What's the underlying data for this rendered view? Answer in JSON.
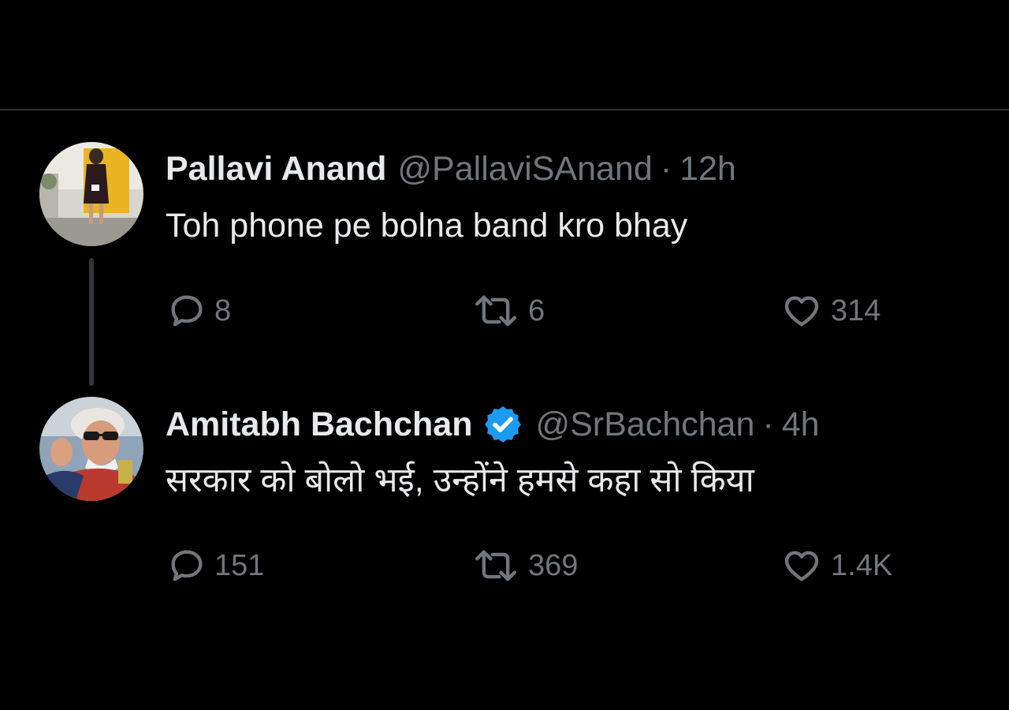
{
  "tweets": [
    {
      "name": "Pallavi Anand",
      "handle": "@PallaviSAnand",
      "separator": "·",
      "time": "12h",
      "verified": false,
      "avatar_icon": "avatar-photo",
      "text": "Toh phone pe bolna band kro bhay",
      "replies": "8",
      "retweets": "6",
      "likes": "314"
    },
    {
      "name": "Amitabh Bachchan",
      "handle": "@SrBachchan",
      "separator": "·",
      "time": "4h",
      "verified": true,
      "avatar_icon": "avatar-photo",
      "text": "सरकार को बोलो भई, उन्होंने हमसे कहा सो किया",
      "replies": "151",
      "retweets": "369",
      "likes": "1.4K"
    }
  ],
  "icons": {
    "reply": "comment-icon",
    "retweet": "retweet-icon",
    "like": "heart-icon",
    "verified": "verified-badge-icon"
  },
  "colors": {
    "background": "#000000",
    "text_primary": "#e7e9ea",
    "text_secondary": "#71767b",
    "verified_blue": "#1d9bf0",
    "divider": "#2f3336"
  }
}
